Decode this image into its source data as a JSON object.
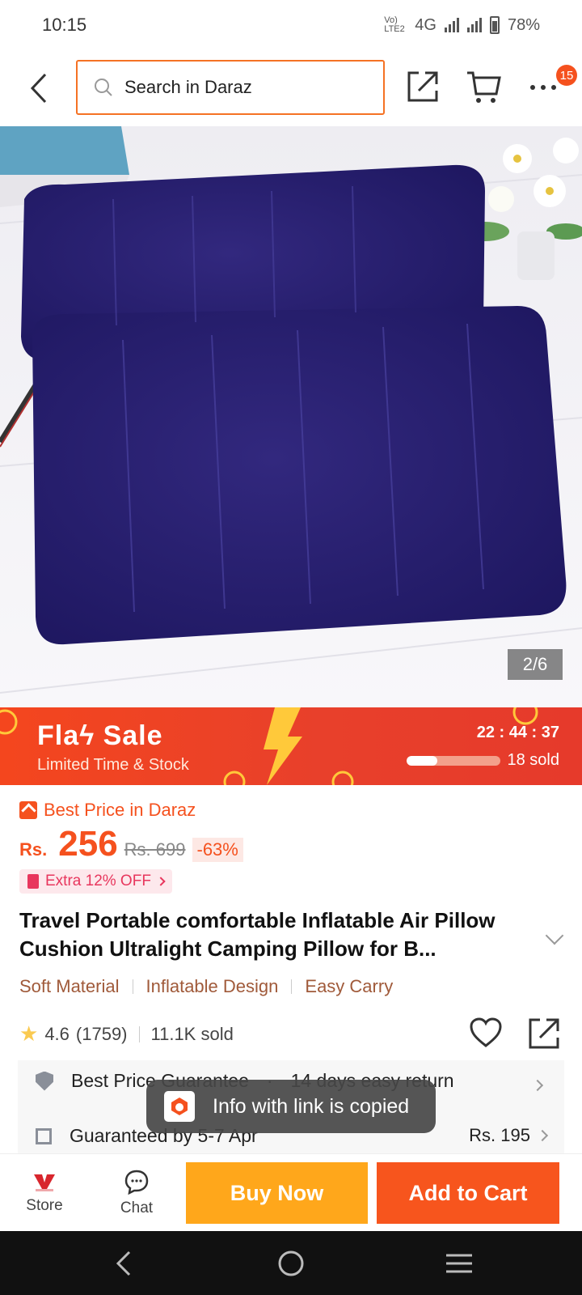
{
  "status_bar": {
    "time": "10:15",
    "network": "4G",
    "lte_label": "Vo) LTE2",
    "battery": "78%"
  },
  "header": {
    "search_placeholder": "Search in Daraz",
    "cart_badge": "15"
  },
  "gallery": {
    "counter": "2/6",
    "current_image": 2,
    "total_images": 6
  },
  "flash_sale": {
    "title": "Flaϟ Sale",
    "subtitle": "Limited Time & Stock",
    "countdown": "22 : 44 : 37",
    "sold": "18 sold",
    "progress_fraction": 0.33
  },
  "pricing": {
    "best_price_label": "Best Price in Daraz",
    "currency": "Rs.",
    "price": "256",
    "original_price": "Rs. 699",
    "discount": "-63%",
    "voucher": "Extra 12% OFF"
  },
  "product": {
    "title": "Travel Portable comfortable Inflatable Air Pillow Cushion Ultralight Camping Pillow for B...",
    "tags": [
      "Soft Material",
      "Inflatable Design",
      "Easy Carry"
    ],
    "rating": "4.6",
    "reviews": "(1759)",
    "sold": "11.1K sold"
  },
  "service": {
    "row1_left": "Best Price Guarantee",
    "row1_dot": "·",
    "row1_right": "14 days easy return",
    "row2_left": "Guaranteed by 5-7 Apr",
    "row2_price": "Rs. 195"
  },
  "toast": {
    "message": "Info with link is copied"
  },
  "bottom_bar": {
    "store_label": "Store",
    "chat_label": "Chat",
    "buy_now": "Buy Now",
    "add_to_cart": "Add to Cart"
  },
  "colors": {
    "brand_orange": "#f57224",
    "buy_now": "#ffa71b",
    "add_to_cart": "#f7551d",
    "flash_red": "#e8402b",
    "price": "#f5511e"
  }
}
